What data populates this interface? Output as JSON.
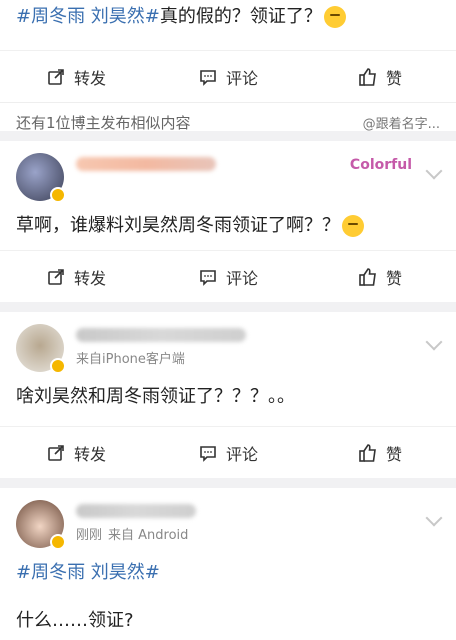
{
  "post1": {
    "tag_text": "#周冬雨 刘昊然#",
    "rest_text": "真的假的？领证了？"
  },
  "actions": {
    "repost": "转发",
    "comment": "评论",
    "like": "赞"
  },
  "similar": {
    "left": "还有1位博主发布相似内容",
    "right": "@跟着名字..."
  },
  "post2": {
    "text": "草啊，谁爆料刘昊然周冬雨领证了啊？？",
    "deco": "Colorful"
  },
  "post3": {
    "source": "来自iPhone客户端",
    "text": "啥刘昊然和周冬雨领证了？？？。。"
  },
  "post4": {
    "time": "刚刚",
    "source": "来自 Android",
    "tag_text": "#周冬雨 刘昊然#",
    "text": "什么……领证?"
  },
  "colors": {
    "tag": "#3a6fb0",
    "background": "#f1f1f3",
    "badge": "#f5b700"
  }
}
